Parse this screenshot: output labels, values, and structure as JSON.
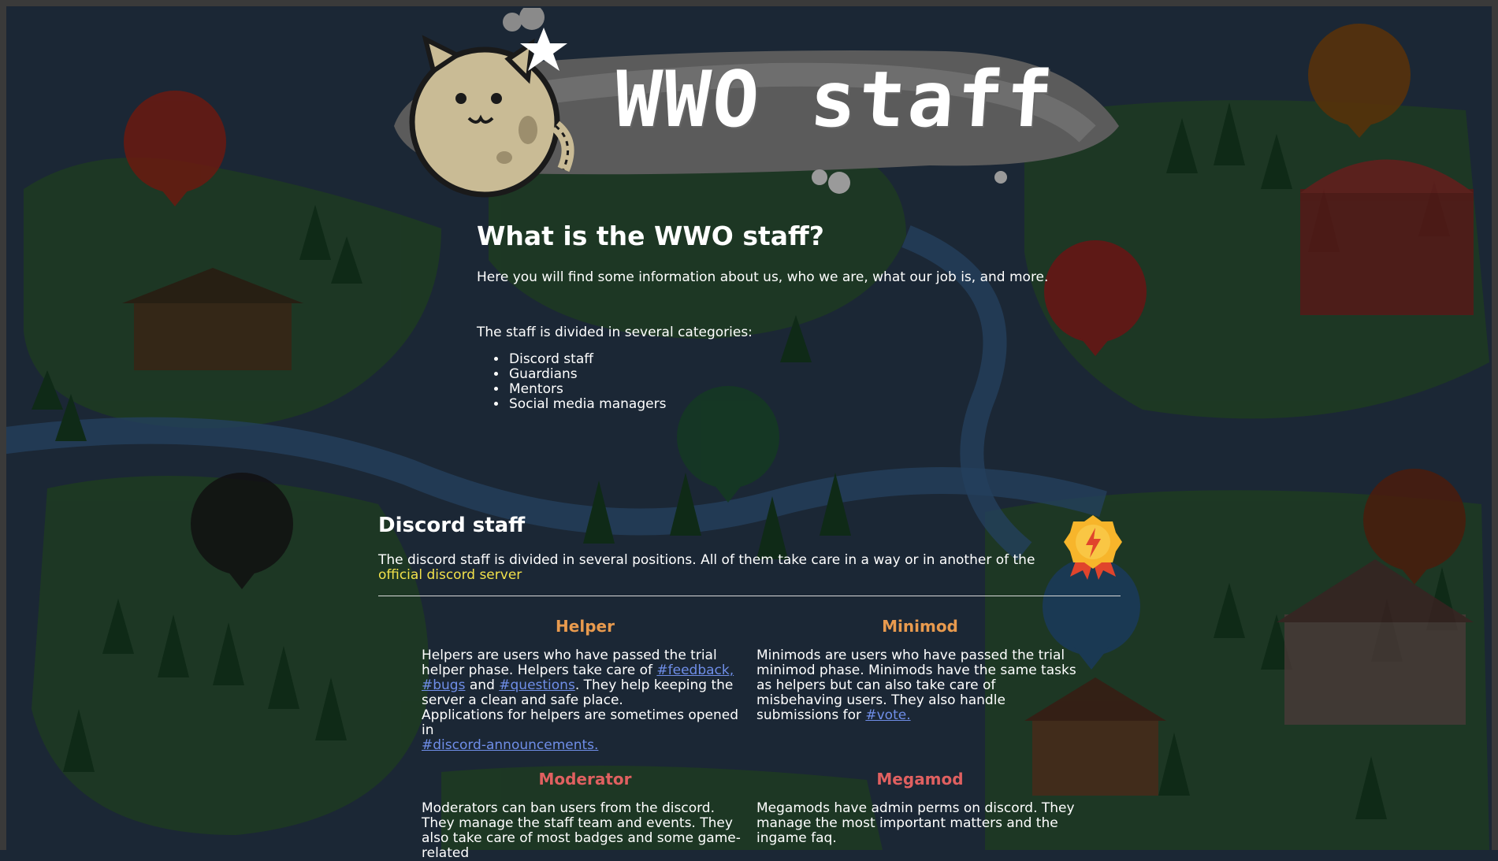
{
  "banner": {
    "title": "WWO staff"
  },
  "main": {
    "heading": "What is the WWO staff?",
    "intro": "Here you will find some information about us, who we are, what our job is, and more.",
    "categories_intro": "The staff is divided in several categories:",
    "categories": [
      "Discord staff",
      "Guardians",
      "Mentors",
      "Social media managers"
    ]
  },
  "discord": {
    "heading": "Discord staff",
    "desc_prefix": "The discord staff is divided in several positions. All of them take care in a way or in another of the ",
    "desc_link": "official discord server"
  },
  "roles": {
    "helper": {
      "title": "Helper",
      "p1": "Helpers are users who have passed the trial helper phase. Helpers take care of ",
      "ch1": "#feedback,",
      "ch2": "#bugs",
      "and": " and ",
      "ch3": "#questions",
      "p2": ". They help keeping the server a clean and safe place.",
      "p3": "Applications for helpers are sometimes opened in",
      "ch4": "#discord-announcements."
    },
    "minimod": {
      "title": "Minimod",
      "p1": "Minimods are users who have passed the trial minimod phase. Minimods have the same tasks as helpers but can also take care of misbehaving users. They also handle submissions for ",
      "ch1": "#vote."
    },
    "moderator": {
      "title": "Moderator",
      "p1": "Moderators can ban users from the discord. They manage the staff team and events. They also take care of most badges and some game-related"
    },
    "megamod": {
      "title": "Megamod",
      "p1": "Megamods have admin perms on discord. They manage the most important matters and the ingame faq."
    }
  },
  "colors": {
    "background": "#1b2735",
    "role_title_orange": "#e89a4e",
    "role_title_red": "#e06060",
    "channel_link": "#6f8ee8",
    "official_link": "#f2e14a"
  },
  "icons": [
    "cat-bomb-logo",
    "medal-badge-icon"
  ]
}
